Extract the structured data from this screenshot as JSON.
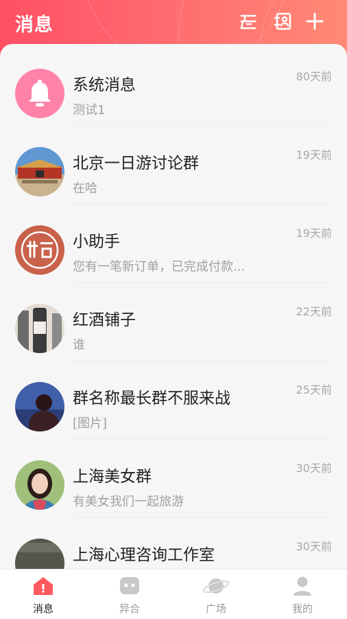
{
  "header": {
    "title": "消息",
    "icons": [
      "cloud-icon",
      "contacts-icon",
      "add-icon"
    ]
  },
  "conversations": [
    {
      "name": "系统消息",
      "preview": "测试1",
      "time": "80天前",
      "avatar": "bell-icon"
    },
    {
      "name": "北京一日游讨论群",
      "preview": "在哈",
      "time": "19天前",
      "avatar": "tiananmen-photo"
    },
    {
      "name": "小助手",
      "preview": "您有一笔新订单，已完成付款...",
      "time": "19天前",
      "avatar": "app-logo"
    },
    {
      "name": "红酒铺子",
      "preview": "谁",
      "time": "22天前",
      "avatar": "wine-photo"
    },
    {
      "name": "群名称最长群不服来战",
      "preview": "[图片]",
      "time": "25天前",
      "avatar": "silhouette-photo"
    },
    {
      "name": "上海美女群",
      "preview": "有美女我们一起旅游",
      "time": "30天前",
      "avatar": "portrait-photo"
    },
    {
      "name": "上海心理咨询工作室",
      "preview": "",
      "time": "30天前",
      "avatar": "dark-photo"
    }
  ],
  "tabbar": {
    "tabs": [
      {
        "label": "消息",
        "active": true
      },
      {
        "label": "异合",
        "active": false
      },
      {
        "label": "广场",
        "active": false
      },
      {
        "label": "我的",
        "active": false
      }
    ]
  },
  "colors": {
    "header_start": "#ff4f64",
    "header_end": "#ff8a75",
    "accent": "#ff5a5f",
    "bell_bg": "#ff7fa8",
    "logo_bg": "#c9614b"
  }
}
